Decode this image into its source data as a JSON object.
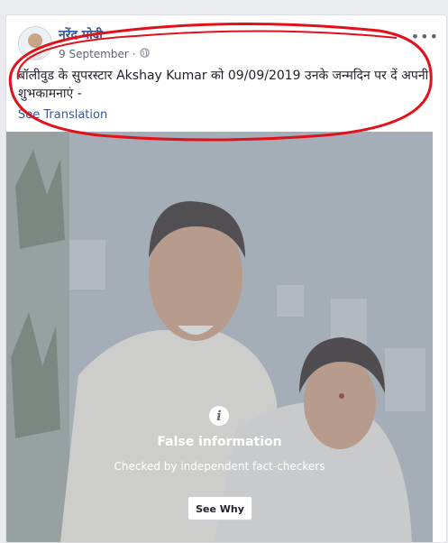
{
  "post": {
    "author_name": "नरेंद्र मोदी",
    "date": "9 September",
    "date_separator": "·",
    "privacy_icon": "globe-icon",
    "more_label": "•••",
    "text": "बॉलीवुड के सुपरस्टार Akshay Kumar को 09/09/2019 उनके जन्मदिन पर दें अपनी शुभकामनाएं -",
    "see_translation": "See Translation"
  },
  "fact_check": {
    "icon": "info-icon",
    "icon_glyph": "i",
    "title": "False information",
    "subtitle": "Checked by independent fact-checkers",
    "button_label": "See Why"
  },
  "colors": {
    "link": "#385898",
    "annotation_red": "#e0111b",
    "overlay": "#969ea8"
  }
}
